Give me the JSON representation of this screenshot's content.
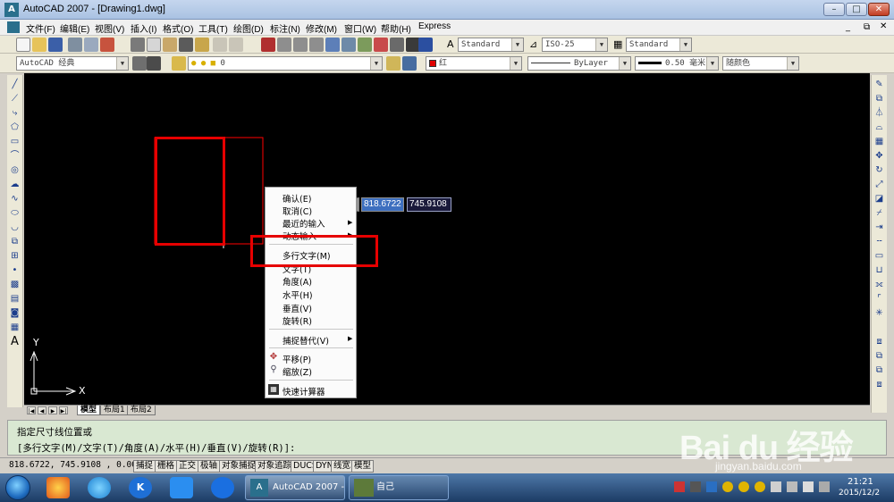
{
  "window": {
    "title": "AutoCAD 2007 - [Drawing1.dwg]",
    "app_icon": "A"
  },
  "menu": [
    "文件(F)",
    "编辑(E)",
    "视图(V)",
    "插入(I)",
    "格式(O)",
    "工具(T)",
    "绘图(D)",
    "标注(N)",
    "修改(M)",
    "窗口(W)",
    "帮助(H)",
    "Express"
  ],
  "toolbar": {
    "text_style": "Standard",
    "dim_style": "ISO-25",
    "table_style": "Standard",
    "workspace": "AutoCAD 经典",
    "layer": "0",
    "color": "红",
    "linetype": "ByLayer",
    "lineweight": "0.50 毫米",
    "plot_style": "随颜色"
  },
  "drawing": {
    "y_axis_label": "Y",
    "x_axis_label": "X"
  },
  "dynamic_input": {
    "x": "818.6722",
    "y": "745.9108"
  },
  "context_menu": {
    "items": [
      {
        "label": "确认(E)"
      },
      {
        "label": "取消(C)"
      },
      {
        "label": "最近的输入",
        "submenu": true
      },
      {
        "label": "动态输入",
        "submenu": true
      },
      {
        "label": "多行文字(M)"
      },
      {
        "label": "文字(T)"
      },
      {
        "label": "角度(A)"
      },
      {
        "label": "水平(H)"
      },
      {
        "label": "垂直(V)"
      },
      {
        "label": "旋转(R)"
      },
      {
        "label": "捕捉替代(V)",
        "submenu": true
      },
      {
        "label": "平移(P)",
        "icon": "pan-icon"
      },
      {
        "label": "缩放(Z)",
        "icon": "zoom-icon"
      },
      {
        "label": "快速计算器",
        "icon": "calculator-icon"
      }
    ]
  },
  "layout_tabs": [
    "模型",
    "布局1",
    "布局2"
  ],
  "command": {
    "line1": "指定尺寸线位置或",
    "line2": "[多行文字(M)/文字(T)/角度(A)/水平(H)/垂直(V)/旋转(R)]:"
  },
  "status": {
    "coords": "818.6722,  745.9108 , 0.0000",
    "buttons": [
      "捕捉",
      "栅格",
      "正交",
      "极轴",
      "对象捕捉",
      "对象追踪",
      "DUCS",
      "DYN",
      "线宽",
      "模型"
    ]
  },
  "taskbar": {
    "tasks": [
      "AutoCAD 2007 -...",
      "自己"
    ],
    "time": "21:21",
    "date": "2015/12/2"
  },
  "watermark": {
    "brand": "Bai du 经验",
    "url": "jingyan.baidu.com"
  },
  "colors": {
    "highlight": "#e60000",
    "canvas": "#000000",
    "entity": "#ff0000"
  }
}
